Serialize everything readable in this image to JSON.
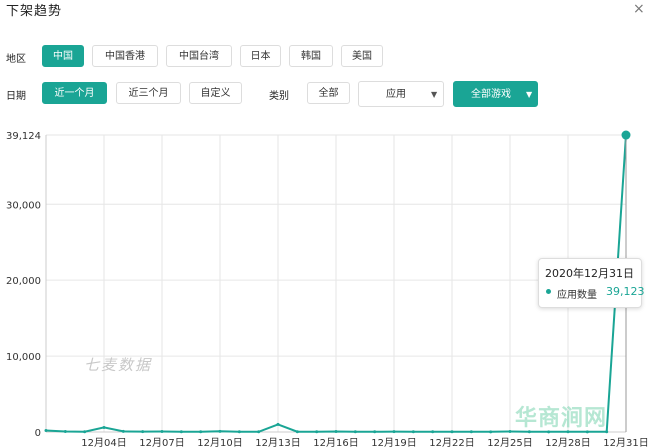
{
  "dialog": {
    "title": "下架趋势",
    "close_icon": "×"
  },
  "region": {
    "label": "地区",
    "options": [
      "中国",
      "中国香港",
      "中国台湾",
      "日本",
      "韩国",
      "美国"
    ],
    "selected": "中国"
  },
  "date": {
    "label": "日期",
    "options": [
      "近一个月",
      "近三个月",
      "自定义"
    ],
    "selected": "近一个月"
  },
  "category": {
    "label": "类别",
    "all_button": "全部",
    "type_select": "应用",
    "game_select": "全部游戏"
  },
  "colors": {
    "accent": "#1aa595",
    "grid": "#e6e6e6"
  },
  "tooltip": {
    "date": "2020年12月31日",
    "label": "应用数量",
    "value": "39,123"
  },
  "watermark": "七麦数据",
  "brand_watermark": "华商涧网",
  "chart_data": {
    "type": "line",
    "x": [
      "12月01日",
      "12月02日",
      "12月03日",
      "12月04日",
      "12月05日",
      "12月06日",
      "12月07日",
      "12月08日",
      "12月09日",
      "12月10日",
      "12月11日",
      "12月12日",
      "12月13日",
      "12月14日",
      "12月15日",
      "12月16日",
      "12月17日",
      "12月18日",
      "12月19日",
      "12月20日",
      "12月21日",
      "12月22日",
      "12月23日",
      "12月24日",
      "12月25日",
      "12月26日",
      "12月27日",
      "12月28日",
      "12月29日",
      "12月30日",
      "12月31日"
    ],
    "series": [
      {
        "values": [
          200,
          60,
          40,
          600,
          80,
          50,
          70,
          40,
          30,
          90,
          40,
          30,
          1000,
          40,
          30,
          60,
          40,
          30,
          50,
          40,
          30,
          40,
          30,
          20,
          60,
          30,
          20,
          30,
          20,
          30,
          39123
        ]
      }
    ],
    "x_ticks": [
      "12月04日",
      "12月07日",
      "12月10日",
      "12月13日",
      "12月16日",
      "12月19日",
      "12月22日",
      "12月25日",
      "12月28日",
      "12月31日"
    ],
    "y_ticks": [
      "0",
      "10,000",
      "20,000",
      "30,000",
      "39,124"
    ],
    "ylim": [
      0,
      39124
    ],
    "grid": true
  }
}
